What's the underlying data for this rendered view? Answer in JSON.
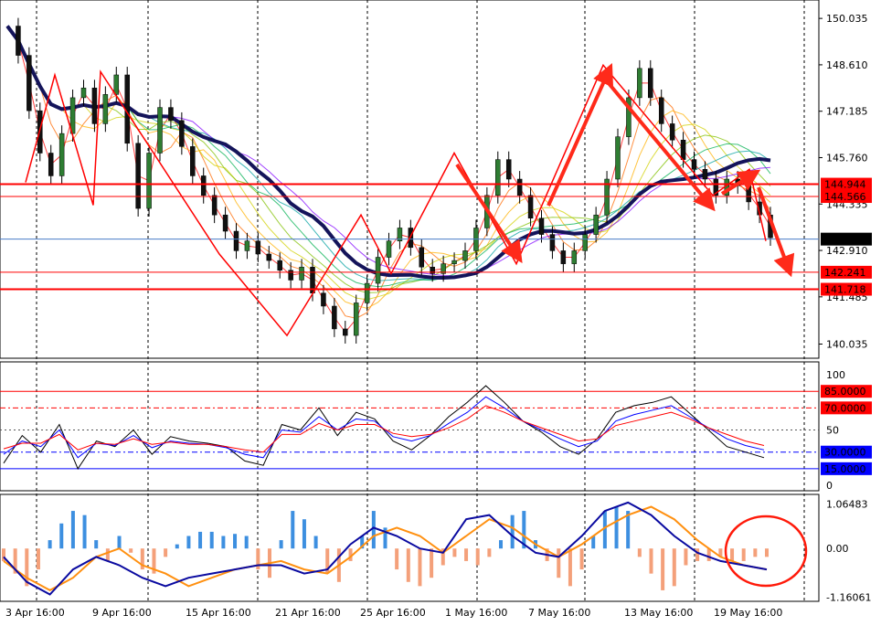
{
  "chart_data": {
    "type": "line",
    "instrument_timeframe": "",
    "x_labels": [
      "3 Apr 16:00",
      "9 Apr 16:00",
      "15 Apr 16:00",
      "21 Apr 16:00",
      "25 Apr 16:00",
      "1 May 16:00",
      "7 May 16:00",
      "13 May 16:00",
      "19 May 16:00"
    ],
    "price": {
      "y_ticks": [
        "150.035",
        "148.610",
        "147.185",
        "145.760",
        "144.335",
        "142.910",
        "141.485",
        "140.035"
      ],
      "ylim": [
        139.6,
        150.6
      ],
      "current_price": "143.258",
      "levels": [
        {
          "label": "144.944",
          "value": 144.944,
          "color": "#ff0000"
        },
        {
          "label": "144.566",
          "value": 144.566,
          "color": "#ff0000"
        },
        {
          "label": "142.241",
          "value": 142.241,
          "color": "#ff0000"
        },
        {
          "label": "141.718",
          "value": 141.718,
          "color": "#ff0000"
        }
      ],
      "close": [
        149.8,
        148.9,
        147.2,
        145.9,
        145.2,
        146.5,
        147.6,
        147.9,
        146.8,
        147.7,
        148.3,
        146.2,
        144.2,
        145.9,
        147.3,
        146.9,
        146.1,
        145.2,
        144.6,
        144.0,
        143.5,
        142.9,
        143.2,
        142.8,
        142.6,
        142.3,
        142.0,
        142.4,
        141.6,
        141.2,
        140.5,
        140.3,
        141.3,
        141.9,
        142.7,
        143.2,
        143.6,
        143.0,
        142.4,
        142.2,
        142.5,
        142.6,
        142.9,
        143.6,
        144.6,
        145.7,
        145.1,
        144.6,
        143.9,
        143.4,
        142.9,
        142.5,
        142.9,
        143.4,
        144.0,
        145.1,
        146.4,
        147.6,
        148.5,
        147.6,
        146.8,
        146.3,
        145.7,
        145.4,
        145.1,
        144.6,
        145.1,
        144.9,
        144.4,
        144.0,
        143.3
      ]
    },
    "oscillator": {
      "y_ticks": [
        "100",
        "50",
        "0"
      ],
      "ylim": [
        0,
        105
      ],
      "levels": [
        {
          "label": "85.0000",
          "value": 85,
          "color": "#ff0000"
        },
        {
          "label": "70.0000",
          "value": 70,
          "color": "#ff0000"
        },
        {
          "label": "30.0000",
          "value": 30,
          "color": "#0000ff"
        },
        {
          "label": "15.0000",
          "value": 15,
          "color": "#0000ff"
        }
      ],
      "series": [
        {
          "color": "#000000",
          "values": [
            20,
            45,
            30,
            55,
            15,
            40,
            35,
            50,
            28,
            44,
            40,
            38,
            35,
            22,
            18,
            55,
            50,
            70,
            45,
            66,
            60,
            40,
            32,
            45,
            62,
            75,
            90,
            75,
            58,
            48,
            35,
            28,
            42,
            66,
            72,
            75,
            80,
            65,
            50,
            35,
            30,
            25
          ]
        },
        {
          "color": "#0000ff",
          "values": [
            28,
            40,
            35,
            50,
            25,
            38,
            36,
            45,
            34,
            40,
            38,
            37,
            34,
            28,
            25,
            50,
            48,
            62,
            50,
            60,
            58,
            44,
            40,
            45,
            56,
            66,
            80,
            70,
            58,
            50,
            42,
            35,
            40,
            58,
            64,
            68,
            72,
            62,
            52,
            42,
            36,
            32
          ]
        },
        {
          "color": "#ff0000",
          "values": [
            33,
            38,
            38,
            46,
            32,
            38,
            37,
            42,
            37,
            39,
            37,
            37,
            35,
            32,
            30,
            46,
            46,
            56,
            50,
            55,
            55,
            47,
            44,
            46,
            52,
            60,
            72,
            66,
            58,
            52,
            46,
            40,
            42,
            54,
            58,
            62,
            66,
            60,
            52,
            46,
            40,
            36
          ]
        }
      ]
    },
    "macd": {
      "y_ticks": [
        "1.06483",
        "0.00",
        "-1.16061"
      ],
      "ylim": [
        -1.22,
        1.12
      ],
      "histogram": [
        -0.3,
        -0.6,
        -0.9,
        -0.5,
        0.2,
        0.6,
        0.9,
        0.8,
        0.2,
        -0.3,
        0.3,
        -0.1,
        -0.5,
        -0.6,
        -0.2,
        0.1,
        0.3,
        0.4,
        0.4,
        0.3,
        0.35,
        0.3,
        -0.5,
        -0.7,
        0.2,
        0.9,
        0.7,
        0.3,
        -0.6,
        -0.8,
        -0.3,
        0.3,
        0.9,
        0.5,
        -0.5,
        -0.8,
        -0.9,
        -0.7,
        -0.4,
        -0.2,
        -0.3,
        -0.4,
        -0.2,
        0.2,
        0.8,
        0.9,
        0.2,
        -0.3,
        -0.7,
        -0.9,
        -0.5,
        0.3,
        0.9,
        1.0,
        0.9,
        -0.2,
        -0.6,
        -1.0,
        -0.9,
        -0.4,
        -0.3,
        -0.3,
        -0.2,
        -0.3,
        -0.3,
        -0.2,
        -0.2
      ],
      "signal": [
        -0.3,
        -0.7,
        -1.0,
        -0.7,
        -0.2,
        0.0,
        -0.4,
        -0.6,
        -0.9,
        -0.7,
        -0.5,
        -0.4,
        -0.3,
        -0.5,
        -0.6,
        -0.2,
        0.3,
        0.5,
        0.3,
        -0.1,
        0.3,
        0.7,
        0.5,
        0.1,
        -0.2,
        0.1,
        0.5,
        0.8,
        1.0,
        0.7,
        0.2,
        -0.2,
        -0.4,
        -0.5
      ],
      "main": [
        -0.2,
        -0.8,
        -1.1,
        -0.5,
        -0.2,
        -0.4,
        -0.7,
        -0.9,
        -0.7,
        -0.6,
        -0.5,
        -0.4,
        -0.4,
        -0.6,
        -0.5,
        0.1,
        0.5,
        0.3,
        0.0,
        -0.1,
        0.7,
        0.8,
        0.3,
        -0.1,
        -0.2,
        0.3,
        0.9,
        1.1,
        0.8,
        0.3,
        -0.1,
        -0.3,
        -0.4,
        -0.5
      ]
    },
    "annotation": {
      "circle": "red ellipse around recent MACD bars",
      "arrows": "red trend arrows on price panel"
    }
  }
}
